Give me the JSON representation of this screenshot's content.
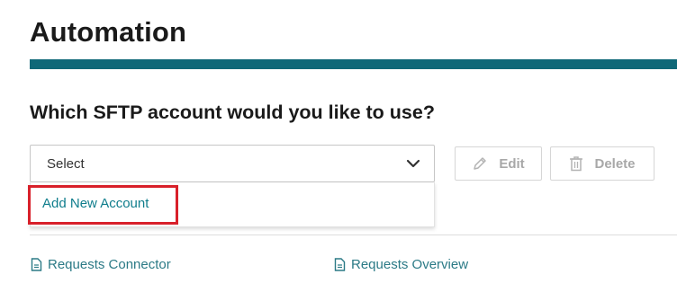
{
  "header": {
    "title": "Automation"
  },
  "question": "Which SFTP account would you like to use?",
  "account_select": {
    "value": "Select",
    "options": [
      "Add New Account"
    ]
  },
  "buttons": {
    "edit": "Edit",
    "delete": "Delete"
  },
  "links": [
    {
      "label": "Requests Connector",
      "icon": "document-icon"
    },
    {
      "label": "Requests Overview",
      "icon": "document-icon"
    }
  ],
  "colors": {
    "accent_bar": "#0f6878",
    "link": "#2b7a86",
    "highlight": "#d8202a",
    "disabled_text": "#a8a8a8"
  }
}
